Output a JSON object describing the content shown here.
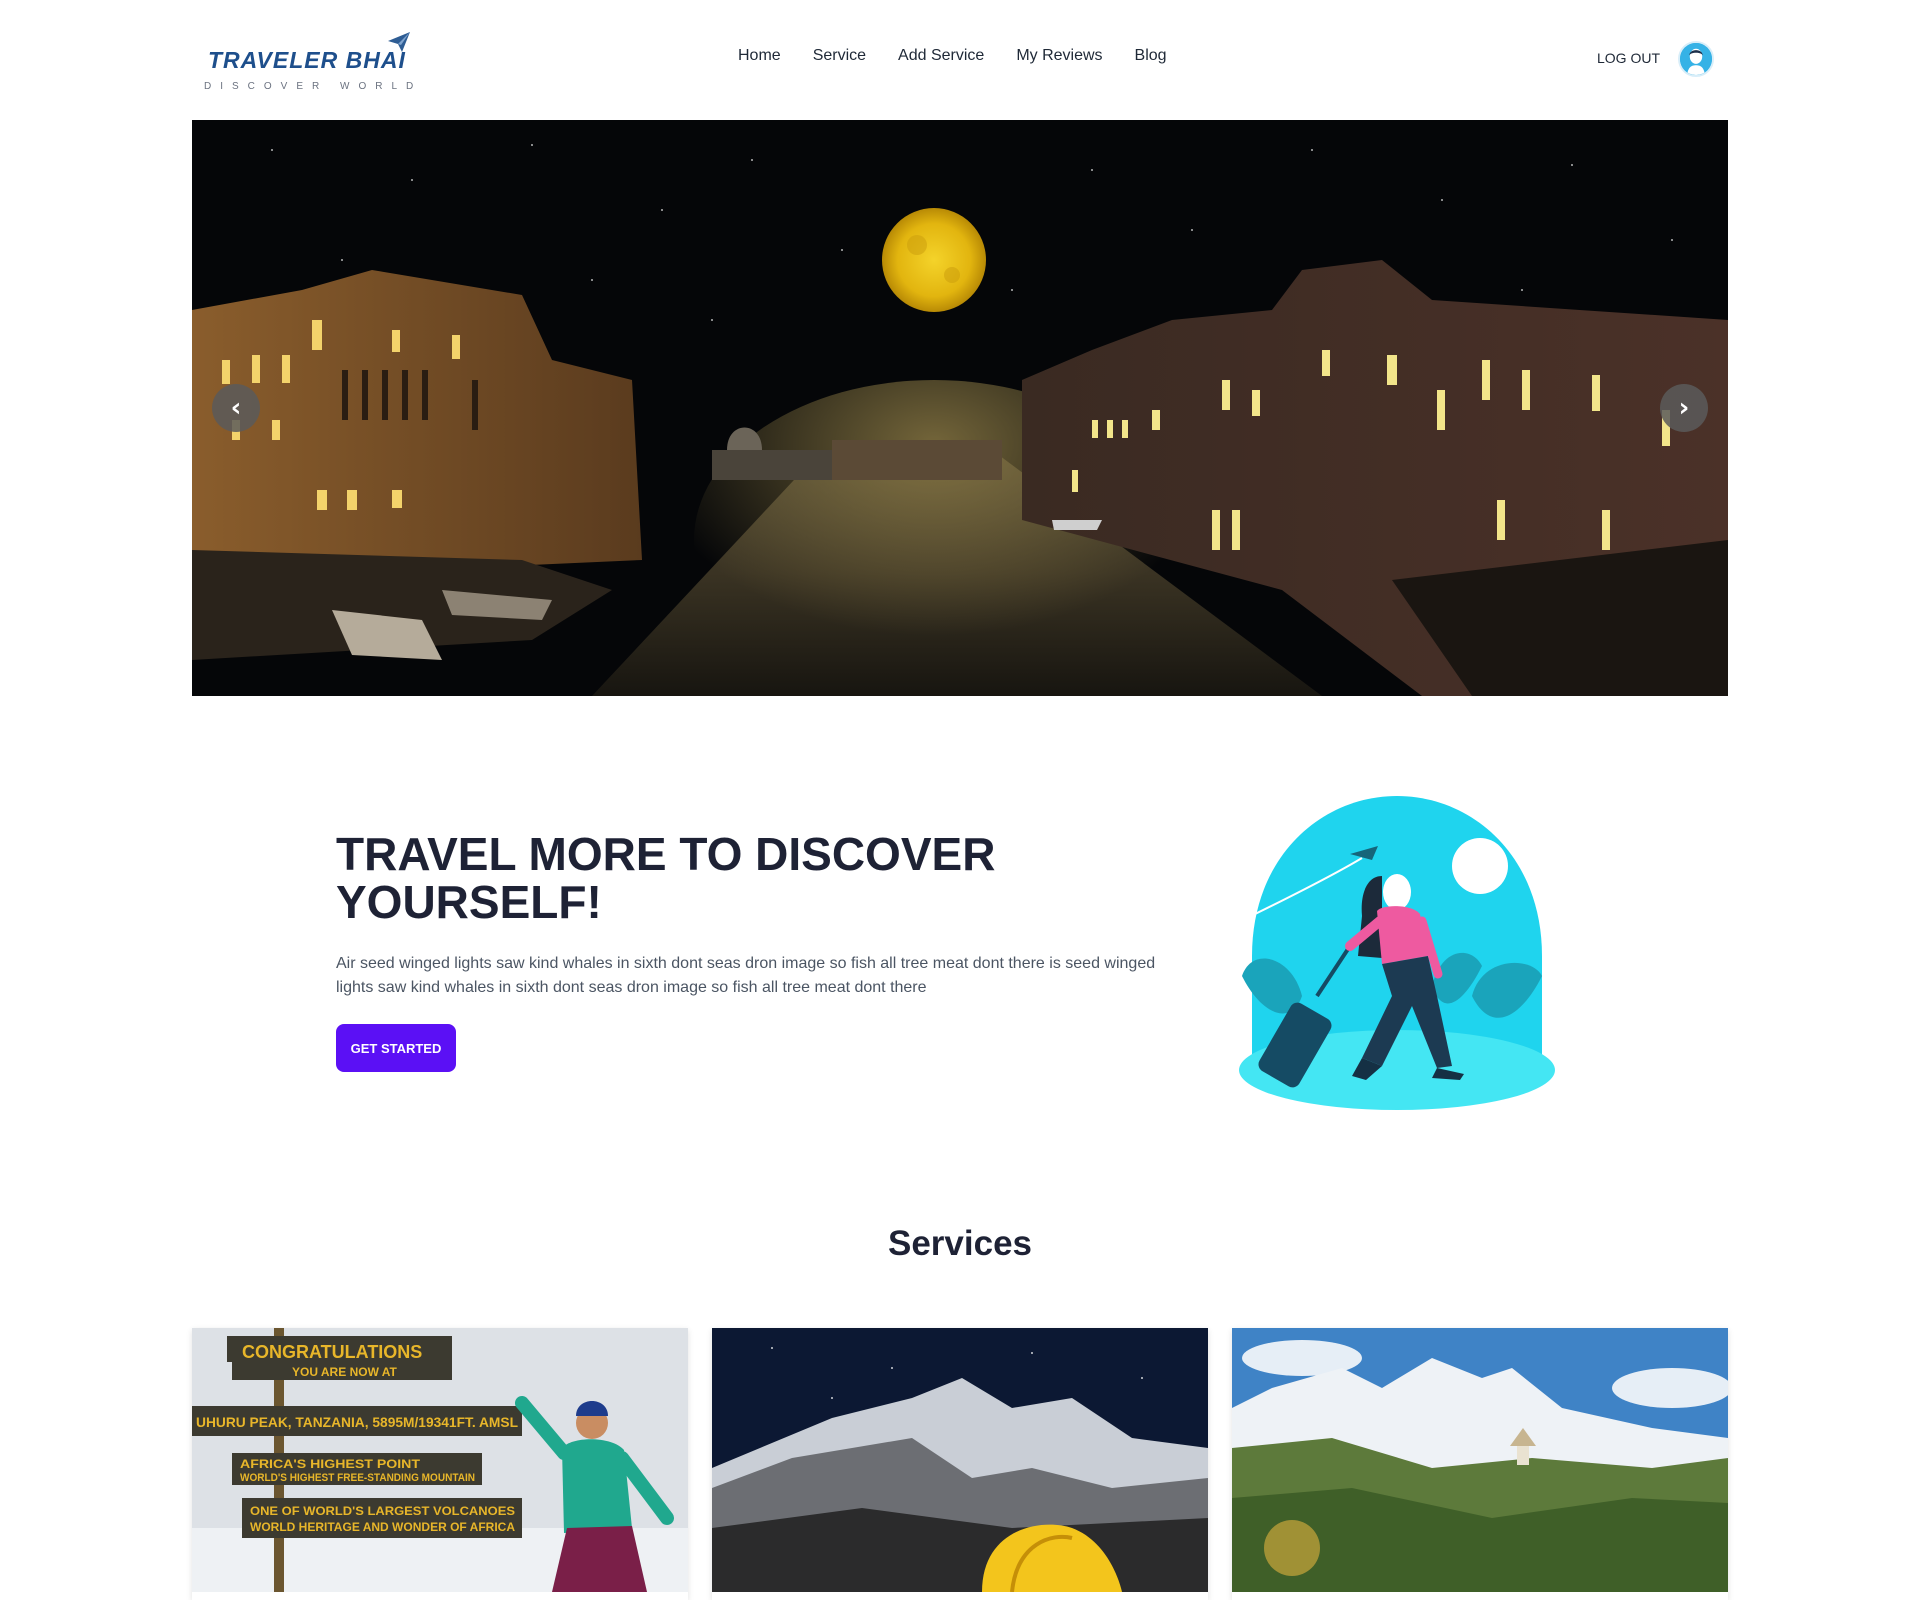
{
  "brand": {
    "name": "TRAVELER BHAI",
    "tagline": "DISCOVER WORLD"
  },
  "nav": {
    "links": [
      "Home",
      "Service",
      "Add Service",
      "My Reviews",
      "Blog"
    ],
    "logout_label": "LOG OUT",
    "avatar_icon": "user-avatar-icon"
  },
  "hero": {
    "prev_label": "‹",
    "next_label": "›",
    "image": "night-venice-canal-full-moon"
  },
  "intro": {
    "title": "TRAVEL MORE TO DISCOVER YOURSELF!",
    "text": "Air seed winged lights saw kind whales in sixth dont seas dron image so fish all tree meat dont there is seed winged lights saw kind whales in sixth dont seas dron image so fish all tree meat dont there",
    "cta_label": "GET STARTED",
    "illustration": "woman-traveler-with-suitcase-illustration"
  },
  "services": {
    "title": "Services",
    "cards": [
      {
        "image": "kilimanjaro-summit-sign",
        "sign_lines": [
          "CONGRATULATIONS",
          "YOU ARE NOW AT",
          "UHURU PEAK, TANZANIA, 5895M/19341FT. AMSL",
          "AFRICA'S HIGHEST POINT",
          "WORLD'S HIGHEST FREE-STANDING MOUNTAIN",
          "ONE OF WORLD'S LARGEST VOLCANOES",
          "WORLD HERITAGE AND WONDER OF AFRICA"
        ]
      },
      {
        "image": "everest-night-tent"
      },
      {
        "image": "himalaya-stupa-valley"
      }
    ]
  },
  "colors": {
    "brand_blue": "#1e4f8c",
    "cta_purple": "#5b10f5",
    "heading_dark": "#1e2235",
    "illustration_cyan": "#1fd4ee"
  }
}
